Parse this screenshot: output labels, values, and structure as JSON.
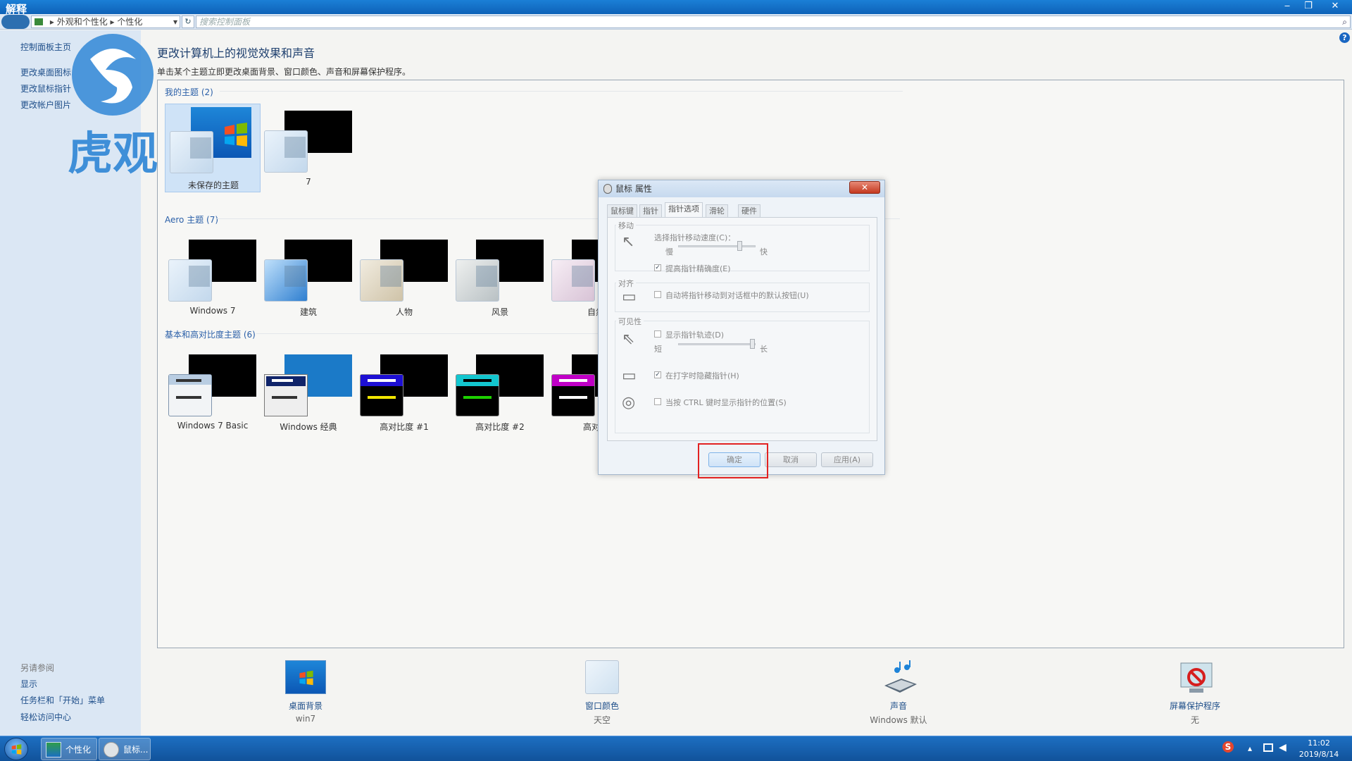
{
  "window": {
    "title": "解释",
    "minimize": "‒",
    "restore": "❐",
    "close": "✕"
  },
  "addressbar": {
    "crumb1": "外观和个性化",
    "sep": "▸",
    "crumb2": "个性化",
    "dropdown": "▾",
    "refresh": "↻",
    "search_placeholder": "搜索控制面板"
  },
  "sidebar": {
    "home": "控制面板主页",
    "links": [
      "更改桌面图标",
      "更改鼠标指针",
      "更改帐户图片"
    ],
    "see_also": "另请参阅",
    "also_links": [
      "显示",
      "任务栏和「开始」菜单",
      "轻松访问中心"
    ]
  },
  "watermark": {
    "text": "虎观"
  },
  "main": {
    "title": "更改计算机上的视觉效果和声音",
    "description": "单击某个主题立即更改桌面背景、窗口颜色、声音和屏幕保护程序。",
    "my_themes_title": "我的主题 (2)",
    "my_themes": [
      "未保存的主题",
      "7"
    ],
    "aero_title": "Aero 主题 (7)",
    "aero_themes": [
      "Windows 7",
      "建筑",
      "人物",
      "风景",
      "自然"
    ],
    "basic_title": "基本和高对比度主题 (6)",
    "basic_themes": [
      "Windows 7 Basic",
      "Windows 经典",
      "高对比度 #1",
      "高对比度 #2",
      "高对比"
    ]
  },
  "dialog": {
    "title": "鼠标 属性",
    "close": "✕",
    "tabs": [
      "鼠标键",
      "指针",
      "指针选项",
      "滑轮",
      "硬件"
    ],
    "motion_group": "移动",
    "speed_label": "选择指针移动速度(C)：",
    "slow": "慢",
    "fast": "快",
    "precision": "提高指针精确度(E)",
    "snap_group": "对齐",
    "snap_label": "自动将指针移动到对话框中的默认按钮(U)",
    "visibility_group": "可见性",
    "trails_label": "显示指针轨迹(D)",
    "short": "短",
    "long": "长",
    "hide_label": "在打字时隐藏指针(H)",
    "ctrl_label": "当按 CTRL 键时显示指针的位置(S)",
    "ok": "确定",
    "cancel": "取消",
    "apply": "应用(A)",
    "checkmark": "✓"
  },
  "settings": [
    {
      "title": "桌面背景",
      "sub": "win7"
    },
    {
      "title": "窗口颜色",
      "sub": "天空"
    },
    {
      "title": "声音",
      "sub": "Windows 默认"
    },
    {
      "title": "屏幕保护程序",
      "sub": "无"
    }
  ],
  "taskbar": {
    "items": [
      "个性化",
      "鼠标..."
    ],
    "time": "11:02",
    "date": "2019/8/14",
    "tray_s": "S",
    "tray_arrow": "▴"
  },
  "colors": {
    "accent": "#1a66c2",
    "highlight": "#e22222",
    "link": "#1f4f8a"
  }
}
